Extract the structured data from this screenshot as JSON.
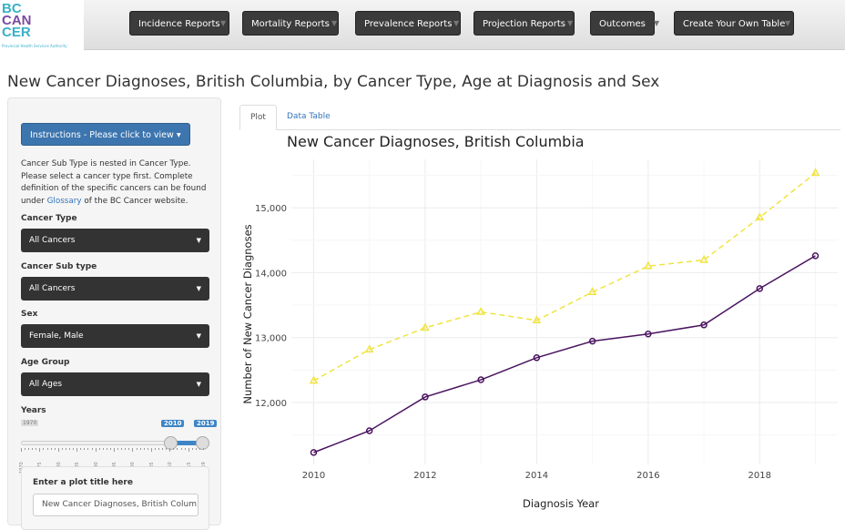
{
  "logo": {
    "lines": [
      "BC",
      "CAN",
      "CER"
    ],
    "subtitle": "Provincial Health Services Authority"
  },
  "nav": [
    "Incidence Reports",
    "Mortality Reports",
    "Prevalence Reports",
    "Projection Reports",
    "Outcomes",
    "Create Your Own Table"
  ],
  "page_title": "New Cancer Diagnoses, British Columbia, by Cancer Type, Age at Diagnosis and Sex",
  "sidebar": {
    "instructions_label": "Instructions - Please click to view",
    "desc_pre": "Cancer Sub Type is nested in Cancer Type. Please select a cancer type first. Complete definition of the specific cancers can be found under ",
    "desc_link": "Glossary",
    "desc_post": " of the BC Cancer website.",
    "cancer_type_label": "Cancer Type",
    "cancer_type": "All Cancers",
    "sub_type_label": "Cancer Sub type",
    "sub_type": "All Cancers",
    "sex_label": "Sex",
    "sex": "Female, Male",
    "age_label": "Age Group",
    "age": "All Ages",
    "years_label": "Years",
    "years_min": "1970",
    "years_from": "2010",
    "years_to": "2019",
    "year_ticks": [
      "1970",
      "1975",
      "1980",
      "1985",
      "1990",
      "1995",
      "2000",
      "2005",
      "2010",
      "2015",
      "2019"
    ],
    "plot_title_label": "Enter a plot title here",
    "plot_title_value": "New Cancer Diagnoses, British Colum"
  },
  "tabs": [
    "Plot",
    "Data Table"
  ],
  "colors": {
    "series1": "#4a1460",
    "series2": "#f0e442",
    "nav": "#3b3b3b",
    "accent": "#3d75ae"
  },
  "chart_data": {
    "type": "line",
    "title": "New Cancer Diagnoses, British Columbia",
    "xlabel": "Diagnosis Year",
    "ylabel": "Number of New Cancer Diagnoses",
    "x": [
      2010,
      2011,
      2012,
      2013,
      2014,
      2015,
      2016,
      2017,
      2018,
      2019
    ],
    "xticks": [
      "2010",
      "2012",
      "2014",
      "2016",
      "2018"
    ],
    "yticks": [
      "12,000",
      "13,000",
      "14,000",
      "15,000"
    ],
    "xlim": [
      2009.6,
      2019.4
    ],
    "ylim": [
      11046,
      15745
    ],
    "grid": true,
    "series": [
      {
        "values": [
          11230,
          11565,
          12085,
          12350,
          12690,
          12945,
          13055,
          13195,
          13755,
          14260
        ],
        "color": "#4a1460",
        "marker": "circle",
        "dash": "solid"
      },
      {
        "values": [
          12335,
          12815,
          13150,
          13395,
          13265,
          13700,
          14100,
          14195,
          14850,
          15535
        ],
        "color": "#f0e442",
        "marker": "triangle",
        "dash": "dashed"
      }
    ]
  }
}
